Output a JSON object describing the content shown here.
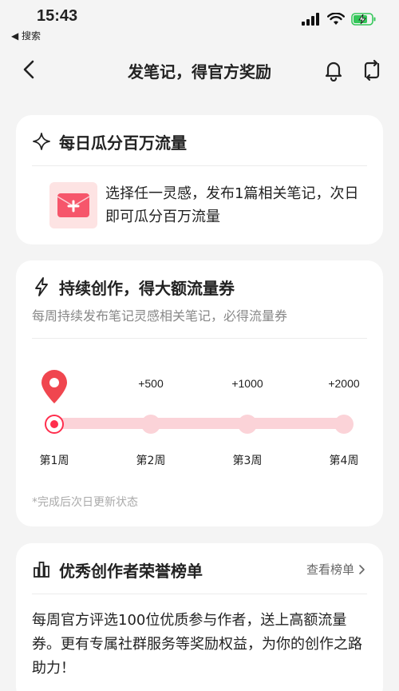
{
  "status": {
    "time": "15:43",
    "back_app": "◀ 搜索"
  },
  "nav": {
    "title": "发笔记，得官方奖励"
  },
  "card1": {
    "title": "每日瓜分百万流量",
    "text": "选择任一灵感，发布1篇相关笔记，次日即可瓜分百万流量"
  },
  "card2": {
    "title": "持续创作，得大额流量券",
    "subtitle": "每周持续发布笔记灵感相关笔记，必得流量券",
    "weeks": [
      {
        "label": "第1周",
        "prize": ""
      },
      {
        "label": "第2周",
        "prize": "+500"
      },
      {
        "label": "第3周",
        "prize": "+1000"
      },
      {
        "label": "第4周",
        "prize": "+2000"
      }
    ],
    "current_week": 1,
    "note": "*完成后次日更新状态"
  },
  "card3": {
    "title": "优秀创作者荣誉榜单",
    "link": "查看榜单",
    "text": "每周官方评选100位优质参与作者，送上高额流量券。更有专属社群服务等奖励权益，为你的创作之路助力！"
  },
  "colors": {
    "accent": "#ff2e4d",
    "track": "#fbd3d8",
    "battery": "#34c759"
  }
}
